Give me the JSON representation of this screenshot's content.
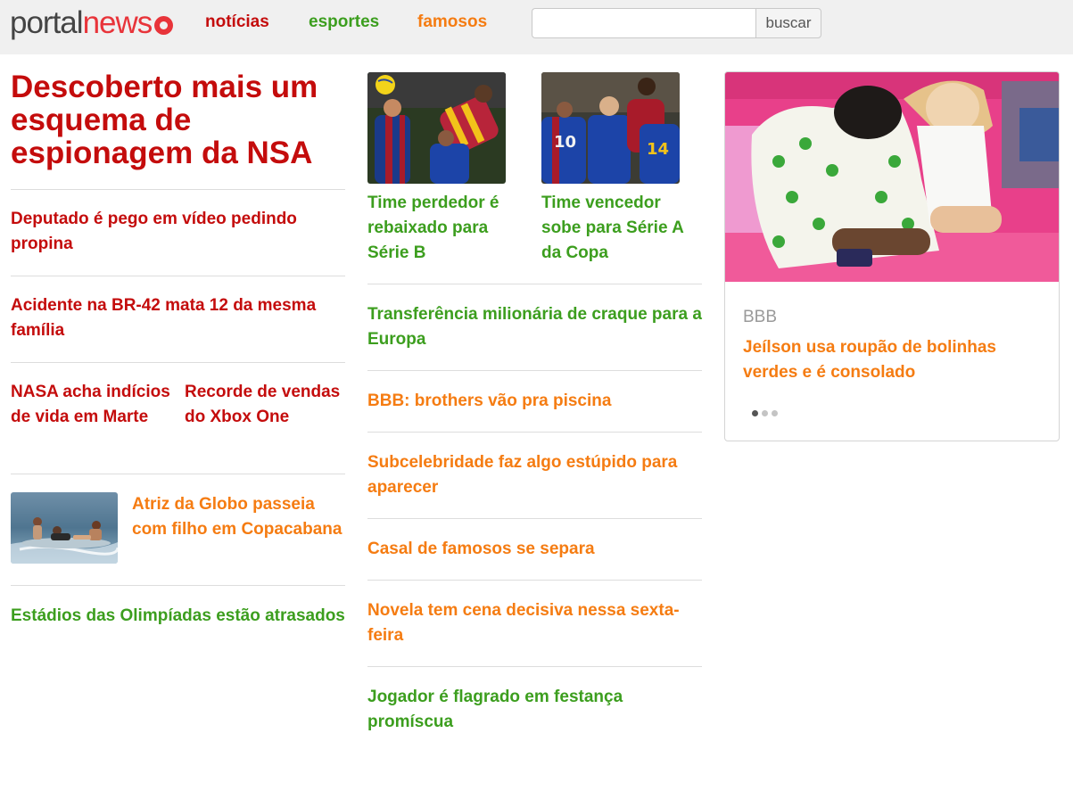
{
  "header": {
    "logo_portal": "portal",
    "logo_news": "news",
    "nav": [
      {
        "label": "notícias",
        "color": "#c40c0c"
      },
      {
        "label": "esportes",
        "color": "#3c9e1e"
      },
      {
        "label": "famosos",
        "color": "#f57c12"
      }
    ],
    "search": {
      "value": "",
      "placeholder": "",
      "button_label": "buscar"
    }
  },
  "left_column": {
    "headline": "Descoberto mais um esquema de espionagem da NSA",
    "stories": [
      "Deputado é pego em vídeo pedindo propina",
      "Acidente na BR-42 mata 12 da mesma família"
    ],
    "pair": [
      "NASA acha indícios de vida em Marte",
      "Recorde de vendas do Xbox One"
    ],
    "thumb_story": "Atriz da Globo passeia com filho em Copacabana",
    "last_story": "Estádios das Olimpíadas estão atrasados"
  },
  "middle_column": {
    "thumb_stories": [
      "Time perdedor é rebaixado para Série B",
      "Time vencedor sobe para Série A da Copa"
    ],
    "stories": [
      {
        "text": "Transferência milionária de craque para a Europa",
        "color": "green"
      },
      {
        "text": "BBB: brothers vão pra piscina",
        "color": "orange"
      },
      {
        "text": "Subcelebridade faz algo estúpido para aparecer",
        "color": "orange"
      },
      {
        "text": "Casal de famosos se separa",
        "color": "orange"
      },
      {
        "text": "Novela tem cena decisiva nessa sexta-feira",
        "color": "orange"
      },
      {
        "text": "Jogador é flagrado em festança promíscua",
        "color": "green"
      }
    ]
  },
  "card": {
    "category": "BBB",
    "title": "Jeílson usa roupão de bolinhas verdes e é consolado",
    "carousel": {
      "total": 3,
      "active": 1
    }
  },
  "colors": {
    "noticias": "#c40c0c",
    "esportes": "#3c9e1e",
    "famosos": "#f57c12",
    "header_bg": "#f0f0f0"
  }
}
